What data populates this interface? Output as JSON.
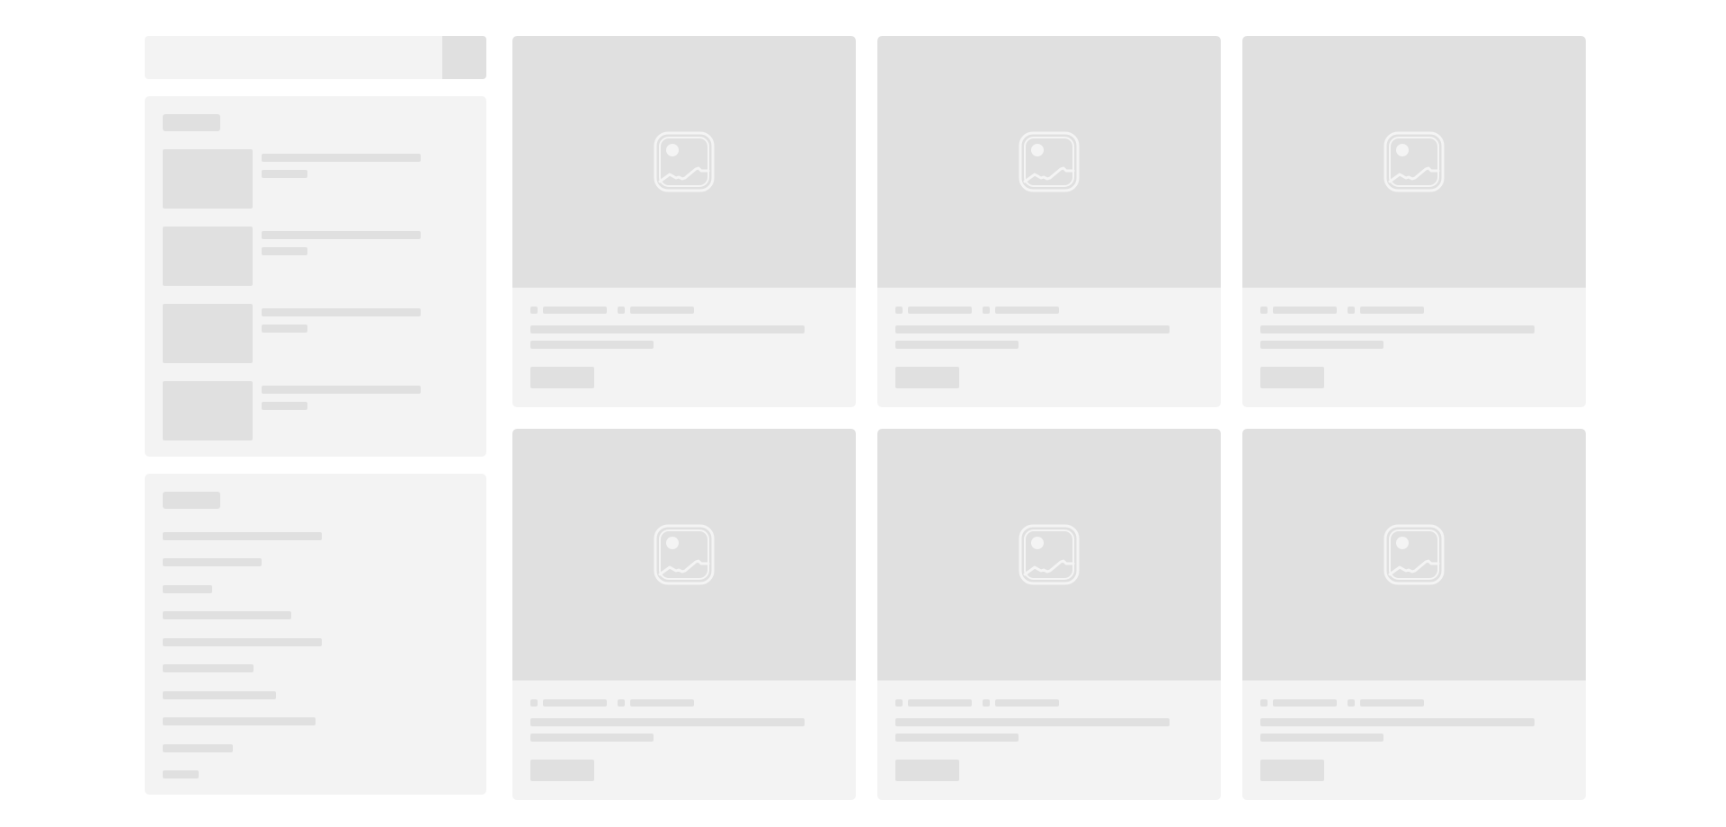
{
  "search": {
    "value": "",
    "placeholder": "",
    "button_icon": "search-icon"
  },
  "colors": {
    "background": "#ffffff",
    "panel": "#f3f3f3",
    "placeholder_block": "#e0e0e0",
    "image_icon_stroke": "#f4f4f4"
  },
  "sidebar": {
    "recent_posts": {
      "count": 4,
      "thumbnail_icon": "image-placeholder"
    },
    "categories": {
      "count": 10
    }
  },
  "posts_grid": {
    "rows": 2,
    "columns": 3,
    "cards": [
      {
        "image_icon": "image-placeholder-icon"
      },
      {
        "image_icon": "image-placeholder-icon"
      },
      {
        "image_icon": "image-placeholder-icon"
      },
      {
        "image_icon": "image-placeholder-icon"
      },
      {
        "image_icon": "image-placeholder-icon"
      },
      {
        "image_icon": "image-placeholder-icon"
      }
    ]
  },
  "state": "loading-skeleton"
}
